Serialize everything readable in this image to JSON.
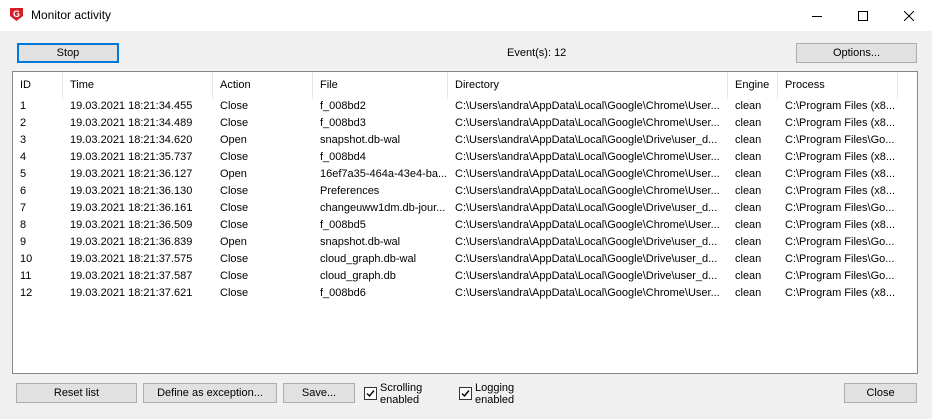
{
  "window": {
    "title": "Monitor activity"
  },
  "toolbar": {
    "stop_label": "Stop",
    "events_text": "Event(s): 12",
    "options_label": "Options..."
  },
  "columns": [
    "ID",
    "Time",
    "Action",
    "File",
    "Directory",
    "Engine",
    "Process"
  ],
  "rows": [
    [
      "1",
      "19.03.2021 18:21:34.455",
      "Close",
      "f_008bd2",
      "C:\\Users\\andra\\AppData\\Local\\Google\\Chrome\\User...",
      "clean",
      "C:\\Program Files (x8..."
    ],
    [
      "2",
      "19.03.2021 18:21:34.489",
      "Close",
      "f_008bd3",
      "C:\\Users\\andra\\AppData\\Local\\Google\\Chrome\\User...",
      "clean",
      "C:\\Program Files (x8..."
    ],
    [
      "3",
      "19.03.2021 18:21:34.620",
      "Open",
      "snapshot.db-wal",
      "C:\\Users\\andra\\AppData\\Local\\Google\\Drive\\user_d...",
      "clean",
      "C:\\Program Files\\Go..."
    ],
    [
      "4",
      "19.03.2021 18:21:35.737",
      "Close",
      "f_008bd4",
      "C:\\Users\\andra\\AppData\\Local\\Google\\Chrome\\User...",
      "clean",
      "C:\\Program Files (x8..."
    ],
    [
      "5",
      "19.03.2021 18:21:36.127",
      "Open",
      "16ef7a35-464a-43e4-ba...",
      "C:\\Users\\andra\\AppData\\Local\\Google\\Chrome\\User...",
      "clean",
      "C:\\Program Files (x8..."
    ],
    [
      "6",
      "19.03.2021 18:21:36.130",
      "Close",
      "Preferences",
      "C:\\Users\\andra\\AppData\\Local\\Google\\Chrome\\User...",
      "clean",
      "C:\\Program Files (x8..."
    ],
    [
      "7",
      "19.03.2021 18:21:36.161",
      "Close",
      "changeuww1dm.db-jour...",
      "C:\\Users\\andra\\AppData\\Local\\Google\\Drive\\user_d...",
      "clean",
      "C:\\Program Files\\Go..."
    ],
    [
      "8",
      "19.03.2021 18:21:36.509",
      "Close",
      "f_008bd5",
      "C:\\Users\\andra\\AppData\\Local\\Google\\Chrome\\User...",
      "clean",
      "C:\\Program Files (x8..."
    ],
    [
      "9",
      "19.03.2021 18:21:36.839",
      "Open",
      "snapshot.db-wal",
      "C:\\Users\\andra\\AppData\\Local\\Google\\Drive\\user_d...",
      "clean",
      "C:\\Program Files\\Go..."
    ],
    [
      "10",
      "19.03.2021 18:21:37.575",
      "Close",
      "cloud_graph.db-wal",
      "C:\\Users\\andra\\AppData\\Local\\Google\\Drive\\user_d...",
      "clean",
      "C:\\Program Files\\Go..."
    ],
    [
      "11",
      "19.03.2021 18:21:37.587",
      "Close",
      "cloud_graph.db",
      "C:\\Users\\andra\\AppData\\Local\\Google\\Drive\\user_d...",
      "clean",
      "C:\\Program Files\\Go..."
    ],
    [
      "12",
      "19.03.2021 18:21:37.621",
      "Close",
      "f_008bd6",
      "C:\\Users\\andra\\AppData\\Local\\Google\\Chrome\\User...",
      "clean",
      "C:\\Program Files (x8..."
    ]
  ],
  "footer": {
    "reset_label": "Reset list",
    "exception_label": "Define as exception...",
    "save_label": "Save...",
    "scrolling_label_1": "Scrolling",
    "scrolling_label_2": "enabled",
    "scrolling_checked": true,
    "logging_label_1": "Logging",
    "logging_label_2": "enabled",
    "logging_checked": true,
    "close_label": "Close"
  },
  "icons": {
    "app": "gdata-shield-icon",
    "minimize": "minimize-icon",
    "maximize": "maximize-icon",
    "close": "close-icon",
    "checkbox": "check-icon"
  },
  "colors": {
    "app_icon_red": "#d21f26",
    "default_button_border": "#0078d7",
    "window_bg": "#f0f0f0"
  }
}
